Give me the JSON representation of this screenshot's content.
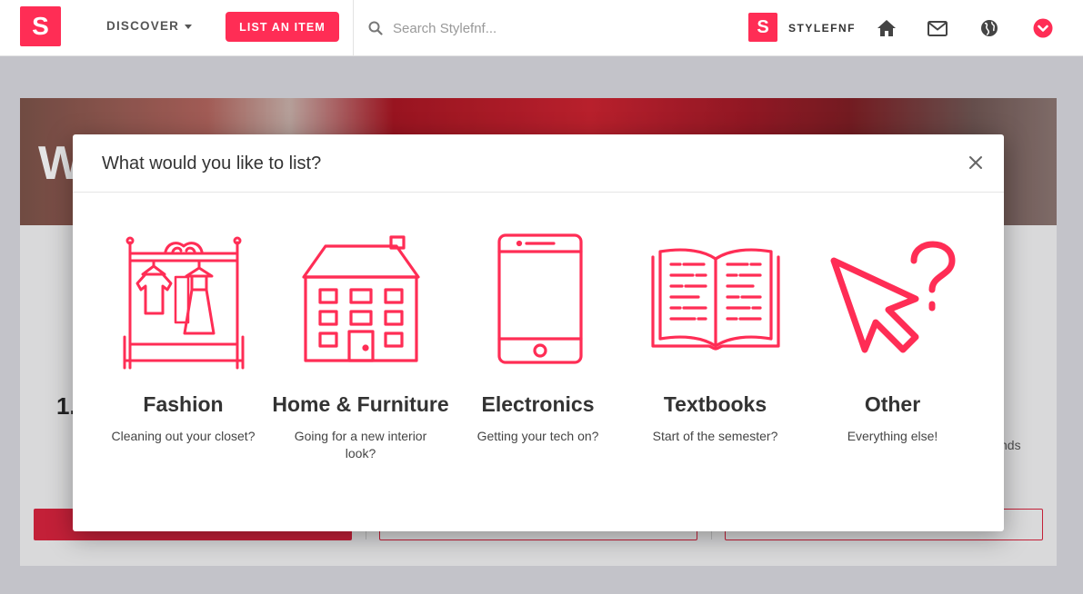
{
  "header": {
    "logo_letter": "S",
    "discover_label": "DISCOVER",
    "list_item_label": "LIST AN ITEM",
    "search_placeholder": "Search Stylefnf...",
    "brand_letter": "S",
    "brand_name": "STYLEFNF",
    "icons": [
      "home-icon",
      "mail-icon",
      "globe-icon",
      "chevron-down-icon"
    ]
  },
  "background_page": {
    "hero_text": "W",
    "step_number": "1.",
    "side_text": "nds"
  },
  "modal": {
    "title": "What would you like to list?",
    "categories": [
      {
        "name": "Fashion",
        "description": "Cleaning out your closet?",
        "icon": "wardrobe-icon"
      },
      {
        "name": "Home & Furniture",
        "description": "Going for a new interior look?",
        "icon": "house-icon"
      },
      {
        "name": "Electronics",
        "description": "Getting your tech on?",
        "icon": "phone-icon"
      },
      {
        "name": "Textbooks",
        "description": "Start of the semester?",
        "icon": "book-icon"
      },
      {
        "name": "Other",
        "description": "Everything else!",
        "icon": "cursor-question-icon"
      }
    ]
  },
  "colors": {
    "brand": "#ff2d55",
    "accent_dark": "#d91f3a"
  }
}
